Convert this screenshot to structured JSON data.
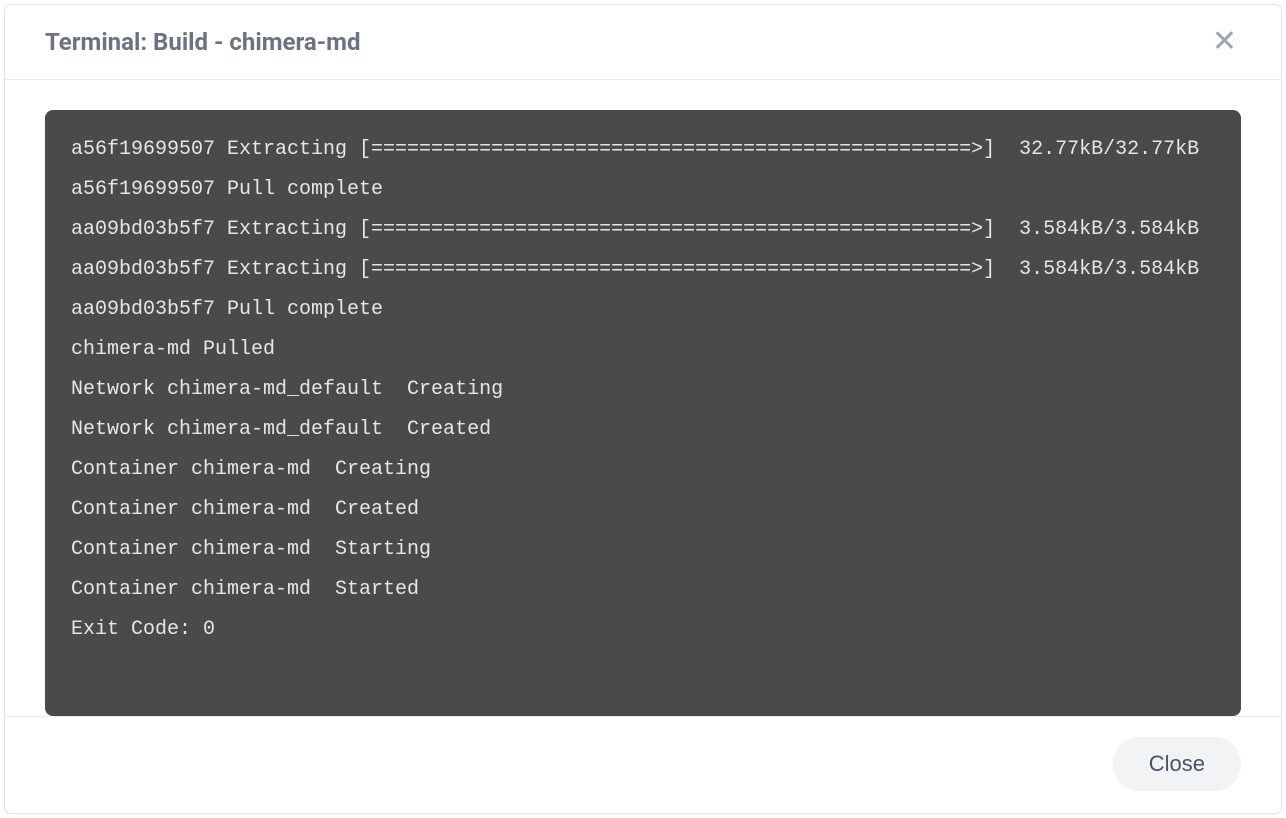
{
  "modal": {
    "title": "Terminal: Build - chimera-md",
    "close_icon": "✕"
  },
  "terminal": {
    "lines": [
      "a56f19699507 Extracting [==================================================>]  32.77kB/32.77kB",
      "a56f19699507 Pull complete",
      "aa09bd03b5f7 Extracting [==================================================>]  3.584kB/3.584kB",
      "aa09bd03b5f7 Extracting [==================================================>]  3.584kB/3.584kB",
      "aa09bd03b5f7 Pull complete",
      "chimera-md Pulled",
      "Network chimera-md_default  Creating",
      "Network chimera-md_default  Created",
      "Container chimera-md  Creating",
      "Container chimera-md  Created",
      "Container chimera-md  Starting",
      "Container chimera-md  Started",
      "Exit Code: 0"
    ]
  },
  "footer": {
    "close_label": "Close"
  }
}
